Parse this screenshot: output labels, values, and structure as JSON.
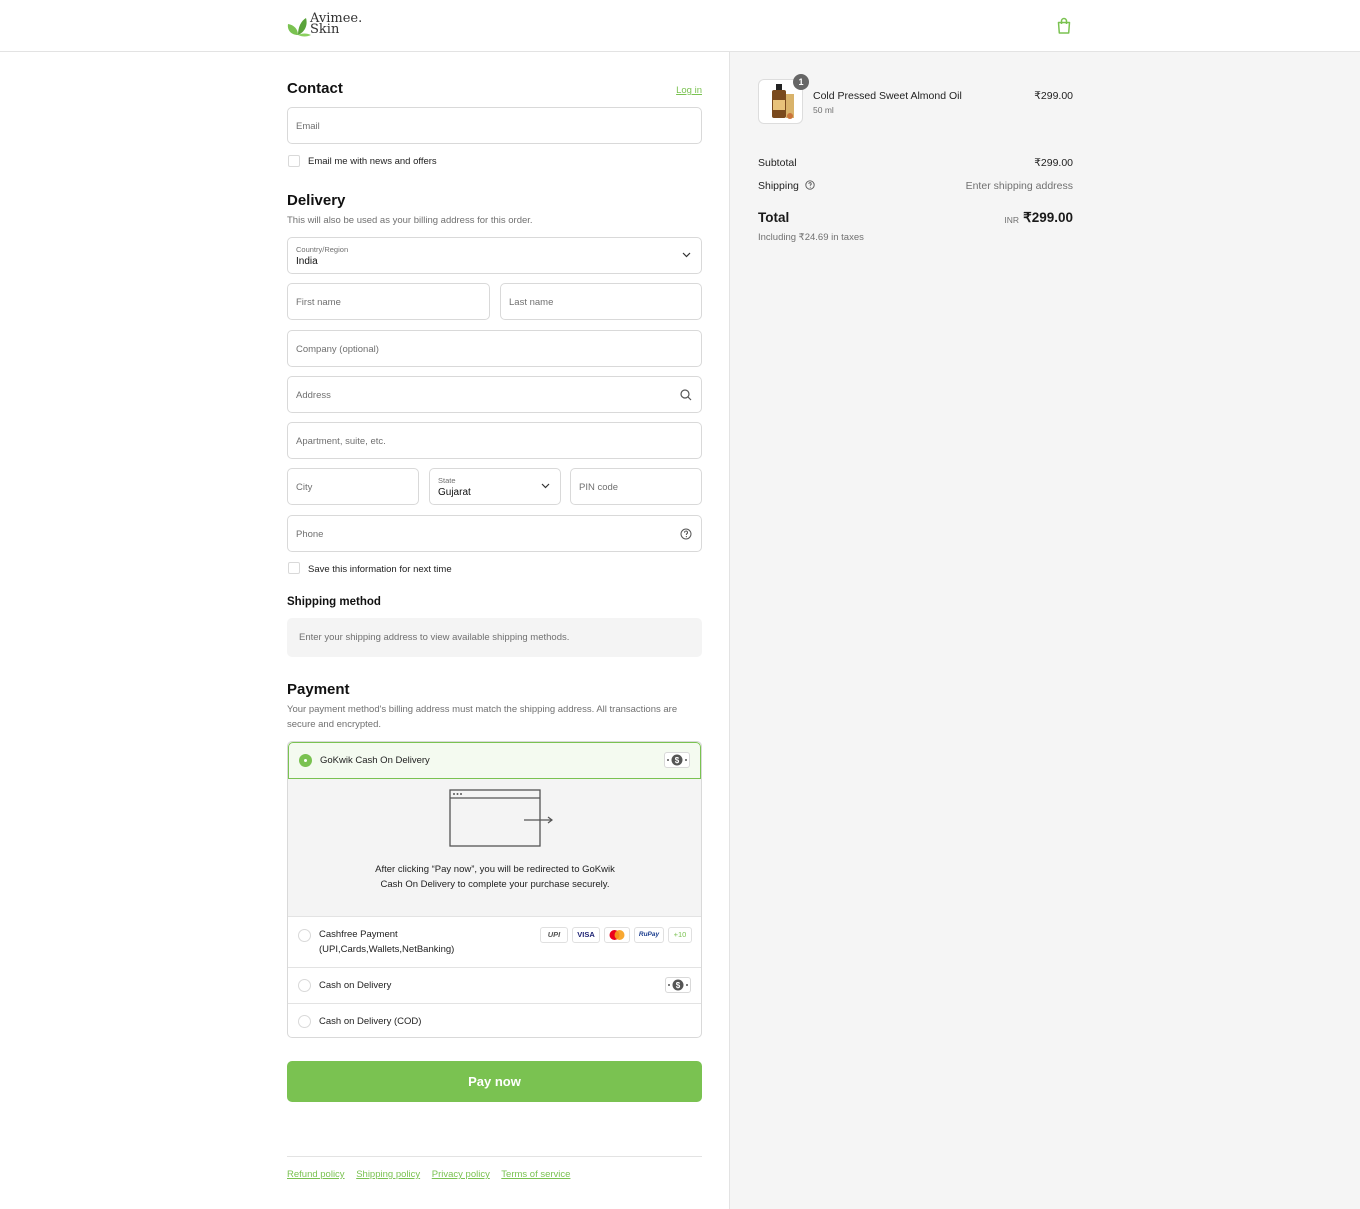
{
  "brand": {
    "name": "Avimee.",
    "sub": "Skin"
  },
  "header": {
    "cart_icon": "shopping-bag-icon"
  },
  "contact": {
    "title": "Contact",
    "login_link": "Log in",
    "email_placeholder": "Email",
    "news_checkbox_label": "Email me with news and offers"
  },
  "delivery": {
    "title": "Delivery",
    "note": "This will also be used as your billing address for this order.",
    "country_label": "Country/Region",
    "country_value": "India",
    "first_name_placeholder": "First name",
    "last_name_placeholder": "Last name",
    "company_placeholder": "Company (optional)",
    "address_placeholder": "Address",
    "apartment_placeholder": "Apartment, suite, etc.",
    "city_placeholder": "City",
    "state_label": "State",
    "state_value": "Gujarat",
    "pin_placeholder": "PIN code",
    "phone_placeholder": "Phone",
    "save_info_label": "Save this information for next time"
  },
  "shipping_method": {
    "title": "Shipping method",
    "message": "Enter your shipping address to view available shipping methods."
  },
  "payment": {
    "title": "Payment",
    "note": "Your payment method's billing address must match the shipping address. All transactions are secure and encrypted.",
    "options": [
      {
        "label": "GoKwik Cash On Delivery",
        "selected": true
      },
      {
        "label": "Cashfree Payment",
        "label2": "(UPI,Cards,Wallets,NetBanking)",
        "selected": false
      },
      {
        "label": "Cash on Delivery",
        "selected": false
      },
      {
        "label": "Cash on Delivery (COD)",
        "selected": false
      }
    ],
    "redirect_text": "After clicking “Pay now”, you will be redirected to GoKwik Cash On Delivery to complete your purchase securely.",
    "brands": [
      "UPI",
      "VISA",
      "Mastercard",
      "RuPay",
      "+10"
    ]
  },
  "pay_button": "Pay now",
  "footer_links": [
    "Refund policy",
    "Shipping policy",
    "Privacy policy",
    "Terms of service"
  ],
  "order": {
    "product_name": "Cold Pressed Sweet Almond Oil",
    "product_variant": "50 ml",
    "quantity": "1",
    "product_price": "₹299.00",
    "subtotal_label": "Subtotal",
    "subtotal_value": "₹299.00",
    "shipping_label": "Shipping",
    "shipping_value": "Enter shipping address",
    "total_label": "Total",
    "currency": "INR",
    "total_value": "₹299.00",
    "tax_note": "Including ₹24.69 in taxes"
  },
  "colors": {
    "accent": "#7ac251",
    "muted": "#707070",
    "border": "#d9d9d9"
  }
}
